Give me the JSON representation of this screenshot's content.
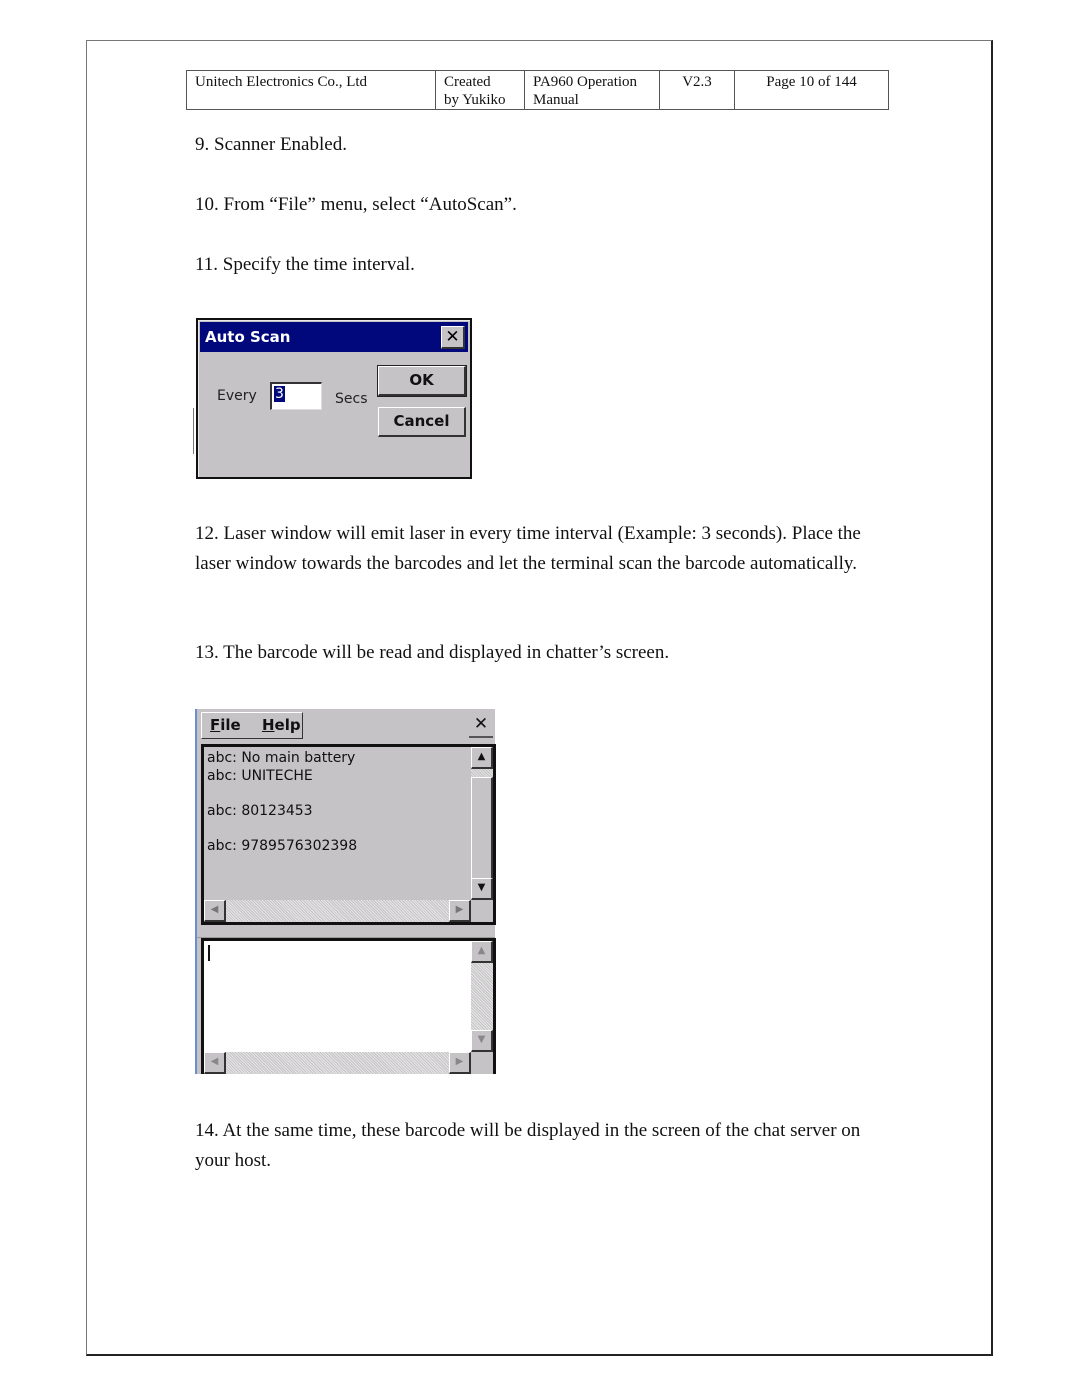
{
  "header": {
    "company": "Unitech Electronics Co., Ltd",
    "created_line1": "Created",
    "created_line2": "by Yukiko",
    "title_line1": "PA960 Operation",
    "title_line2": "Manual",
    "version": "V2.3",
    "page": "Page 10 of 144"
  },
  "steps": {
    "s9": "9. Scanner Enabled.",
    "s10": "10. From “File” menu, select “AutoScan”.",
    "s11": "11. Specify the time interval.",
    "s12": "12. Laser window will emit laser in every time interval (Example: 3 seconds). Place the laser window towards the barcodes and let the terminal scan the barcode automatically.",
    "s13": "13. The barcode will be read and displayed in chatter’s screen.",
    "s14": "14. At the same time, these barcode will be displayed in the screen of the chat server on your host."
  },
  "autoscan_dialog": {
    "title": "Auto Scan",
    "close_glyph": "✕",
    "every_label": "Every",
    "interval_value": "3",
    "secs_label": "Secs",
    "ok_label": "OK",
    "cancel_label": "Cancel",
    "title_color": "#00087b"
  },
  "chatter": {
    "menu": [
      {
        "mnemonic": "F",
        "rest": "ile"
      },
      {
        "mnemonic": "H",
        "rest": "elp"
      }
    ],
    "close_glyph": "✕",
    "log_lines": [
      "abc: No main battery",
      "abc: UNITECHE",
      "",
      "abc: 80123453",
      "",
      "abc: 9789576302398"
    ],
    "input_value": "",
    "scroll_up_glyph": "▲",
    "scroll_down_glyph": "▼",
    "scroll_left_glyph": "◀",
    "scroll_right_glyph": "▶"
  }
}
